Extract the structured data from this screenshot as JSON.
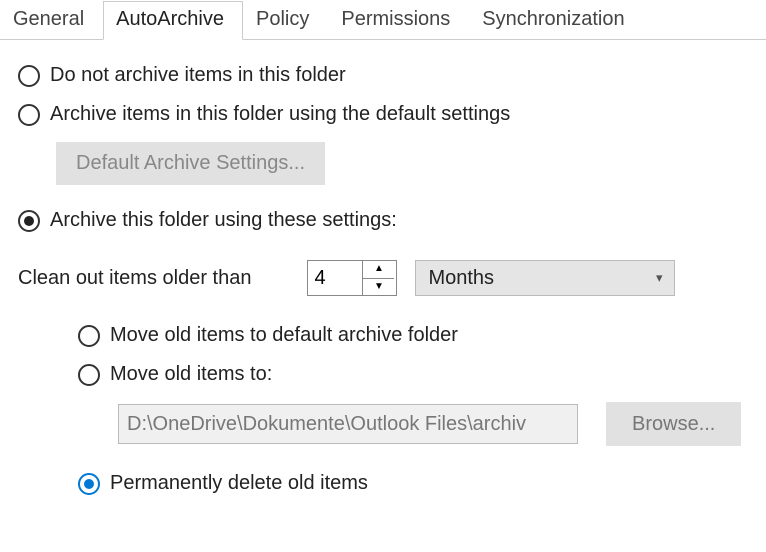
{
  "tabs": {
    "general": "General",
    "autoarchive": "AutoArchive",
    "policy": "Policy",
    "permissions": "Permissions",
    "synchronization": "Synchronization"
  },
  "options": {
    "do_not_archive": "Do not archive items in this folder",
    "use_default": "Archive items in this folder using the default settings",
    "default_btn": "Default Archive Settings...",
    "use_these": "Archive this folder using these settings:",
    "cleanout_label": "Clean out items older than",
    "cleanout_value": "4",
    "cleanout_unit": "Months",
    "move_default": "Move old items to default archive folder",
    "move_to": "Move old items to:",
    "path_value": "D:\\OneDrive\\Dokumente\\Outlook Files\\archiv",
    "browse": "Browse...",
    "perm_delete": "Permanently delete old items"
  }
}
